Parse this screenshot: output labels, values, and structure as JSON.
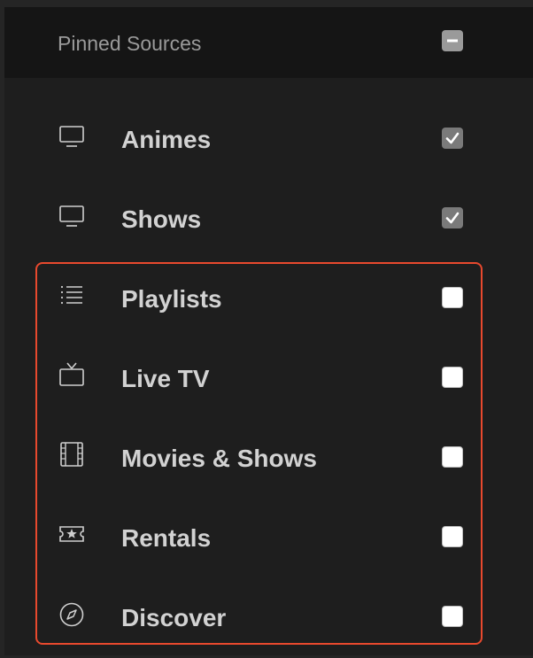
{
  "header": {
    "title": "Pinned Sources",
    "toggle_state": "indeterminate"
  },
  "sources": [
    {
      "label": "Animes",
      "icon": "monitor-icon",
      "checked": true
    },
    {
      "label": "Shows",
      "icon": "monitor-icon",
      "checked": true
    },
    {
      "label": "Playlists",
      "icon": "list-icon",
      "checked": false
    },
    {
      "label": "Live TV",
      "icon": "tv-icon",
      "checked": false
    },
    {
      "label": "Movies & Shows",
      "icon": "film-icon",
      "checked": false
    },
    {
      "label": "Rentals",
      "icon": "ticket-star-icon",
      "checked": false
    },
    {
      "label": "Discover",
      "icon": "compass-icon",
      "checked": false
    }
  ],
  "colors": {
    "highlight": "#e8492e",
    "label": "#d2d2d2",
    "header_text": "#9a9a9a"
  }
}
